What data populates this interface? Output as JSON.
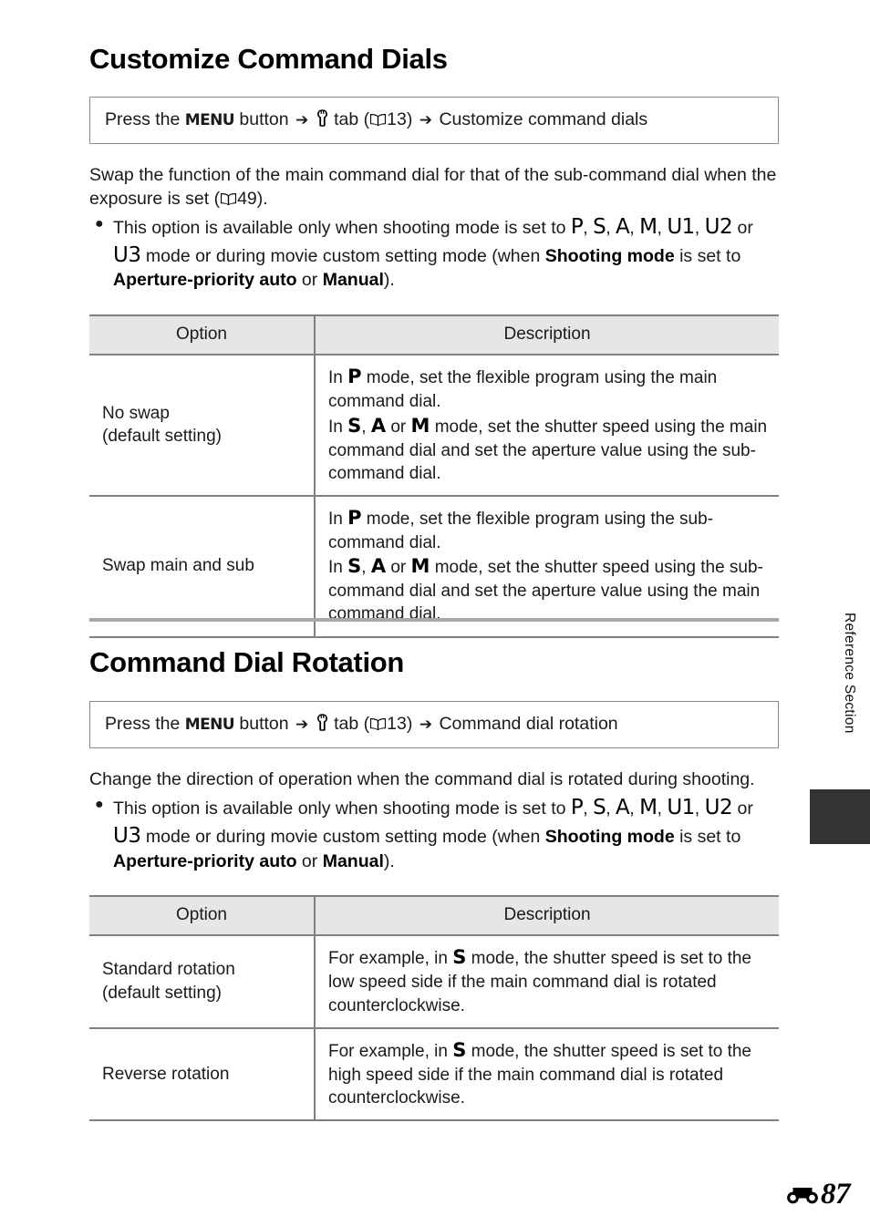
{
  "document": {
    "running_head": "Reference Section",
    "page_number": "87",
    "page_prefix_icon": "reference-section-icon"
  },
  "sections": [
    {
      "title": "Customize Command Dials",
      "path": {
        "prefix": "Press the",
        "menu_label": "MENU",
        "button_word": "button",
        "arrow": "➔",
        "tab_icon": "wrench-icon",
        "tab_word": "tab",
        "ref_open": "(",
        "ref_icon": "book-icon",
        "ref_page": "13",
        "ref_close": ")",
        "arrow2": "➔",
        "target": "Customize command dials"
      },
      "intro": "Swap the function of the main command dial for that of the sub-command dial when the exposure is set (",
      "intro_ref_icon": "book-icon",
      "intro_ref_page": "49",
      "intro_end": ").",
      "bullet": {
        "lead": "This option is available only when shooting mode is set to ",
        "modes": [
          "P",
          "S",
          "A",
          "M",
          "U1",
          "U2",
          "U3"
        ],
        "mid": " mode or during movie custom setting mode (when ",
        "bold1": "Shooting mode",
        "mid2": " is set to ",
        "bold2": "Aperture-priority auto",
        "mid3": " or ",
        "bold3": "Manual",
        "end": ")."
      },
      "table": {
        "headers": [
          "Option",
          "Description"
        ],
        "rows": [
          {
            "option_line1": "No swap",
            "option_line2": "(default setting)",
            "desc_lines": [
              {
                "pre": "In ",
                "mode": "P",
                "post": " mode, set the flexible program using the main command dial."
              },
              {
                "pre": "In ",
                "mode_list": [
                  "S",
                  "A",
                  "M"
                ],
                "post": " mode, set the shutter speed using the main command dial and set the aperture value using the sub-command dial."
              }
            ]
          },
          {
            "option_line1": "Swap main and sub",
            "option_line2": "",
            "desc_lines": [
              {
                "pre": "In ",
                "mode": "P",
                "post": " mode, set the flexible program using the sub-command dial."
              },
              {
                "pre": "In ",
                "mode_list": [
                  "S",
                  "A",
                  "M"
                ],
                "post": " mode, set the shutter speed using the sub-command dial and set the aperture value using the main command dial."
              }
            ]
          }
        ]
      }
    },
    {
      "title": "Command Dial Rotation",
      "path": {
        "prefix": "Press the",
        "menu_label": "MENU",
        "button_word": "button",
        "arrow": "➔",
        "tab_icon": "wrench-icon",
        "tab_word": "tab",
        "ref_open": "(",
        "ref_icon": "book-icon",
        "ref_page": "13",
        "ref_close": ")",
        "arrow2": "➔",
        "target": "Command dial rotation"
      },
      "intro": "Change the direction of operation when the command dial is rotated during shooting.",
      "bullet": {
        "lead": "This option is available only when shooting mode is set to ",
        "modes": [
          "P",
          "S",
          "A",
          "M",
          "U1",
          "U2",
          "U3"
        ],
        "mid": " mode or during movie custom setting mode (when ",
        "bold1": "Shooting mode",
        "mid2": " is set to ",
        "bold2": "Aperture-priority auto",
        "mid3": " or ",
        "bold3": "Manual",
        "end": ")."
      },
      "table": {
        "headers": [
          "Option",
          "Description"
        ],
        "rows": [
          {
            "option_line1": "Standard rotation",
            "option_line2": "(default setting)",
            "desc_pre": "For example, in ",
            "desc_mode": "S",
            "desc_post": " mode, the shutter speed is set to the low speed side if the main command dial is rotated counterclockwise."
          },
          {
            "option_line1": "Reverse rotation",
            "option_line2": "",
            "desc_pre": "For example, in ",
            "desc_mode": "S",
            "desc_post": " mode, the shutter speed is set to the high speed side if the main command dial is rotated counterclockwise."
          }
        ]
      }
    }
  ]
}
